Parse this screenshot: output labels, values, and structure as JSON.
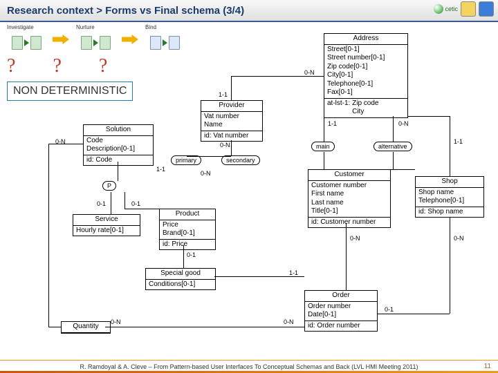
{
  "title": "Research context > Forms vs Final schema (3/4)",
  "logo_text": "cetic",
  "steps": {
    "s1": "Investigate",
    "s2": "Nurture",
    "s3": "Bind"
  },
  "q": "?",
  "nondet": "NON DETERMINISTIC",
  "entities": {
    "address": {
      "name": "Address",
      "attrs": [
        "Street[0-1]",
        "Street number[0-1]",
        "Zip code[0-1]",
        "City[0-1]",
        "Telephone[0-1]",
        "Fax[0-1]"
      ],
      "id": [
        "at-lst-1: Zip code",
        "             City"
      ]
    },
    "provider": {
      "name": "Provider",
      "attrs": [
        "Vat number",
        "Name"
      ],
      "id": "id: Vat number"
    },
    "solution": {
      "name": "Solution",
      "attrs": [
        "Code",
        "Description[0-1]"
      ],
      "id": "id: Code"
    },
    "service": {
      "name": "Service",
      "attrs": [
        "Hourly rate[0-1]"
      ]
    },
    "product": {
      "name": "Product",
      "attrs": [
        "Price",
        "Brand[0-1]"
      ],
      "id": "id: Price"
    },
    "customer": {
      "name": "Customer",
      "attrs": [
        "Customer number",
        "First name",
        "Last name",
        "Title[0-1]"
      ],
      "id": "id: Customer number"
    },
    "shop": {
      "name": "Shop",
      "attrs": [
        "Shop name",
        "Telephone[0-1]"
      ],
      "id": "id: Shop name"
    },
    "specialgood": {
      "name": "Special good",
      "attrs": [
        "Conditions[0-1]"
      ]
    },
    "order": {
      "name": "Order",
      "attrs": [
        "Order number",
        "Date[0-1]"
      ],
      "id": "id: Order number"
    },
    "quantity": {
      "name": "Quantity"
    }
  },
  "rels": {
    "p": "P",
    "main": "main",
    "alternative": "alternative",
    "primary": "primary",
    "secondary": "secondary"
  },
  "cards": {
    "c0n": "0-N",
    "c11": "1-1",
    "c01": "0-1"
  },
  "footer": "R. Ramdoyal & A. Cleve – From Pattern-based User Interfaces To Conceptual Schemas and Back (LVL HMI Meeting 2011)",
  "page": "11"
}
